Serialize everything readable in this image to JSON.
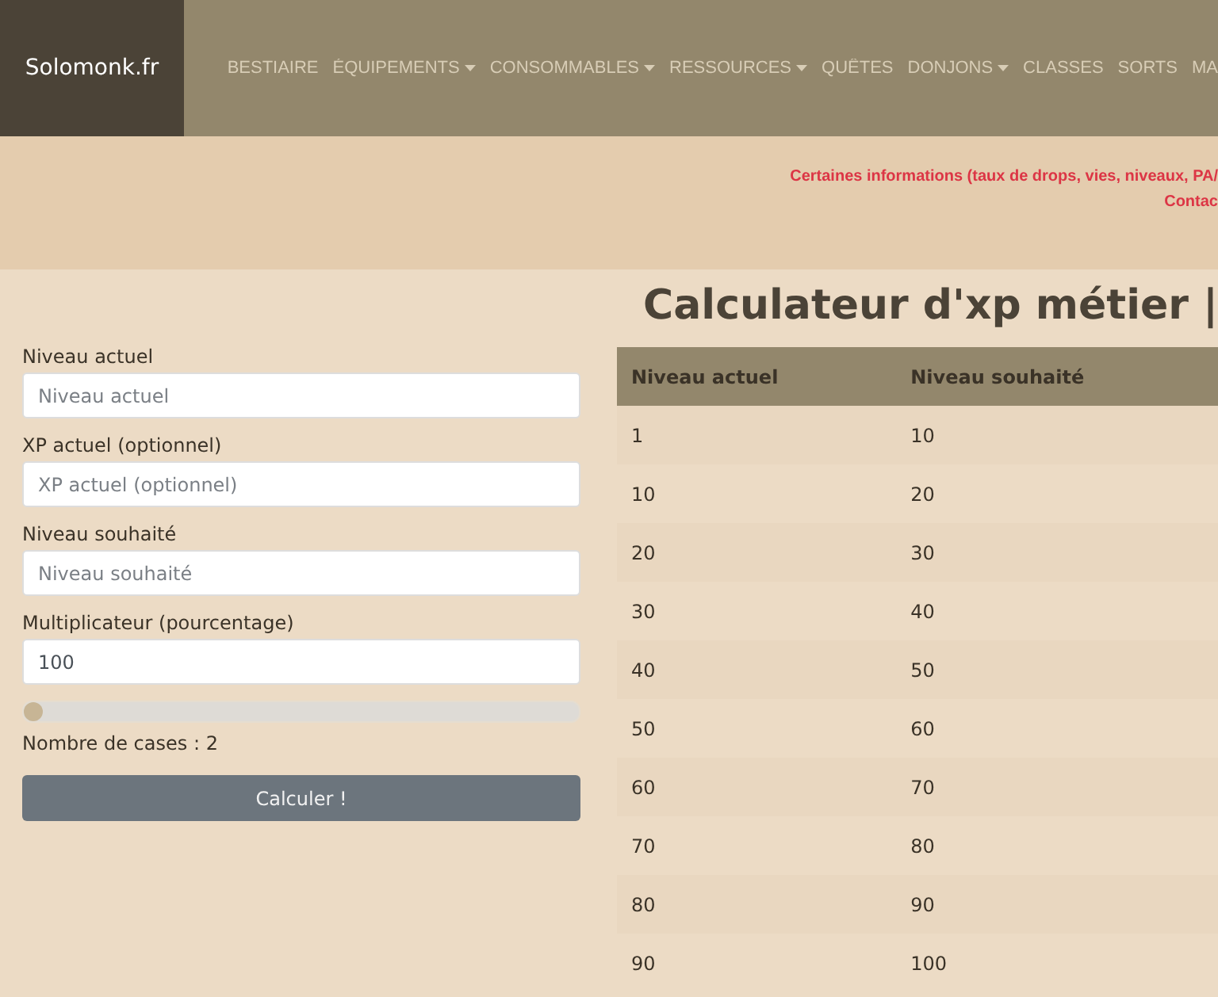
{
  "navbar": {
    "brand": "Solomonk.fr",
    "items": [
      {
        "label": "BESTIAIRE",
        "dropdown": false
      },
      {
        "label": "ÉQUIPEMENTS",
        "dropdown": true
      },
      {
        "label": "CONSOMMABLES",
        "dropdown": true
      },
      {
        "label": "RESSOURCES",
        "dropdown": true
      },
      {
        "label": "QUÊTES",
        "dropdown": false
      },
      {
        "label": "DONJONS",
        "dropdown": true
      },
      {
        "label": "CLASSES",
        "dropdown": false
      },
      {
        "label": "SORTS",
        "dropdown": false
      },
      {
        "label": "MA",
        "dropdown": false
      }
    ]
  },
  "notice": [
    "Certaines informations (taux de drops, vies, niveaux, PA/",
    "Contac"
  ],
  "title": "Calculateur d'xp métier |",
  "form": {
    "fields": [
      {
        "label": "Niveau actuel",
        "placeholder": "Niveau actuel"
      },
      {
        "label": "XP actuel (optionnel)",
        "placeholder": "XP actuel (optionnel)"
      },
      {
        "label": "Niveau souhaité",
        "placeholder": "Niveau souhaité"
      },
      {
        "label": "Multiplicateur (pourcentage)",
        "value": "100"
      }
    ],
    "slider": {
      "level": 0
    },
    "slider_reading": "Nombre de cases : 2",
    "button": "Calculer !"
  },
  "table": {
    "columns": [
      "Niveau actuel",
      "Niveau souhaité"
    ],
    "rows": [
      [
        "1",
        "10"
      ],
      [
        "10",
        "20"
      ],
      [
        "20",
        "30"
      ],
      [
        "30",
        "40"
      ],
      [
        "40",
        "50"
      ],
      [
        "50",
        "60"
      ],
      [
        "60",
        "70"
      ],
      [
        "70",
        "80"
      ],
      [
        "80",
        "90"
      ],
      [
        "90",
        "100"
      ]
    ]
  }
}
